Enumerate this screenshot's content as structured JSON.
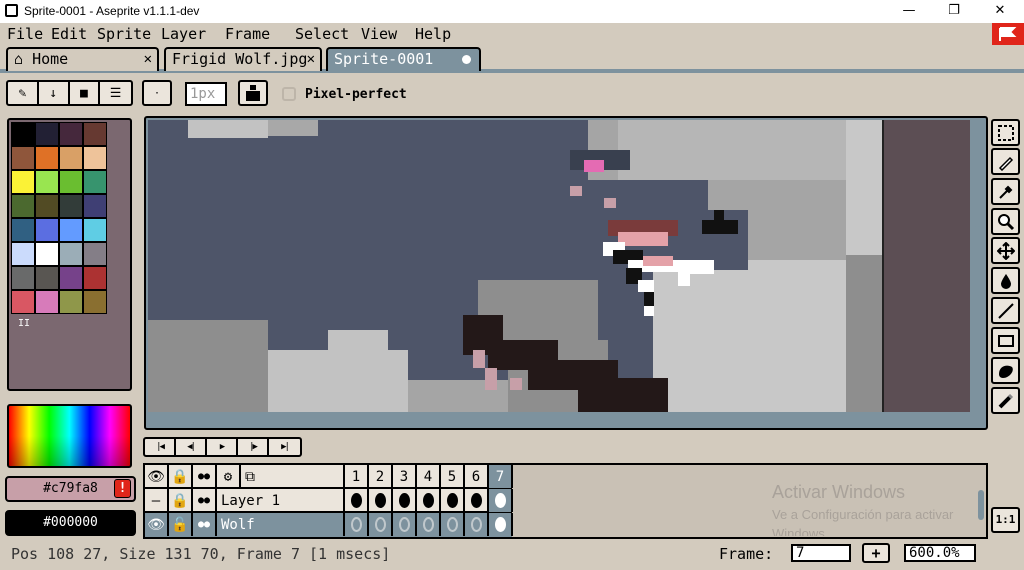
{
  "window": {
    "title": "Sprite-0001 - Aseprite v1.1.1-dev",
    "min": "—",
    "max": "❐",
    "close": "✕"
  },
  "menu": [
    "File",
    "Edit",
    "Sprite",
    "Layer",
    "Frame",
    "Select",
    "View",
    "Help"
  ],
  "tabs": [
    {
      "label": "Home",
      "icon": "home-icon",
      "close": "✕"
    },
    {
      "label": "Frigid Wolf.jpg",
      "close": "✕"
    },
    {
      "label": "Sprite-0001",
      "modified": true
    }
  ],
  "toolbar": {
    "brush_size": "1px",
    "pixel_perfect_label": "Pixel-perfect",
    "pixel_perfect_checked": false
  },
  "palette": {
    "colors": [
      "#000000",
      "#222034",
      "#45283c",
      "#663931",
      "#8f563b",
      "#df7126",
      "#d9a066",
      "#eec39a",
      "#fbf236",
      "#99e550",
      "#6abe30",
      "#37946e",
      "#4b692f",
      "#524b24",
      "#323c39",
      "#3f3f74",
      "#306082",
      "#5b6ee1",
      "#639bff",
      "#5fcde4",
      "#cbdbfc",
      "#ffffff",
      "#9badb7",
      "#847e87",
      "#696a6a",
      "#595652",
      "#76428a",
      "#ac3232",
      "#d95763",
      "#d77bba",
      "#8f974a",
      "#8a6f30"
    ],
    "mark": "II"
  },
  "colors": {
    "foreground": "#c79fa8",
    "background": "#000000",
    "accent": "#e0251a",
    "panel": "#d3cbbe",
    "active_tab": "#7d929e"
  },
  "timeline": {
    "frames": [
      "1",
      "2",
      "3",
      "4",
      "5",
      "6",
      "7"
    ],
    "current_frame": "7",
    "layers": [
      {
        "name": "Layer 1",
        "active": false
      },
      {
        "name": "Wolf",
        "active": true
      }
    ]
  },
  "watermark": {
    "title": "Activar Windows",
    "subtitle": "Ve a Configuración para activar",
    "subtitle2": "Windows."
  },
  "status": {
    "text": "Pos 108 27, Size 131 70, Frame 7 [1 msecs]",
    "frame_label": "Frame:",
    "frame_value": "7",
    "plus": "+",
    "zoom": "600.0%",
    "one_to_one": "1:1"
  }
}
